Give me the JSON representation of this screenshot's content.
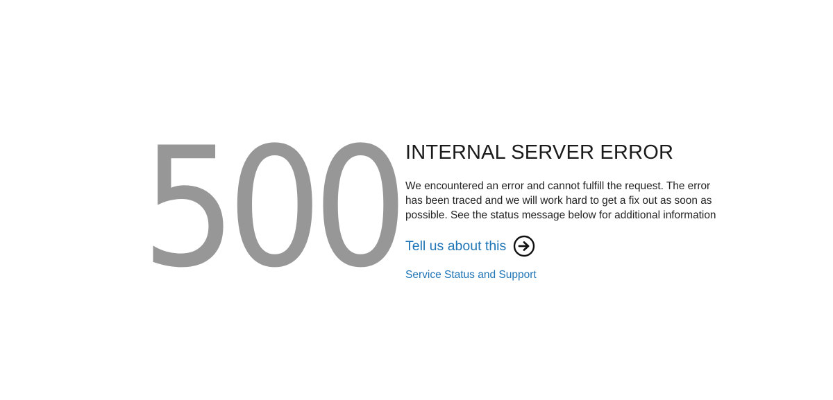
{
  "error": {
    "code": "500",
    "title": "INTERNAL SERVER ERROR",
    "message": "We encountered an error and cannot fulfill the request. The error has been traced and we will work hard to get a fix out as soon as possible. See the status message below for additional information"
  },
  "links": {
    "tell_us_label": "Tell us about this",
    "tell_us_icon": "arrow-circle-right-icon",
    "status_label": "Service Status and Support"
  },
  "colors": {
    "code_gray": "#979797",
    "link_blue": "#1d74b6",
    "text": "#222222"
  }
}
